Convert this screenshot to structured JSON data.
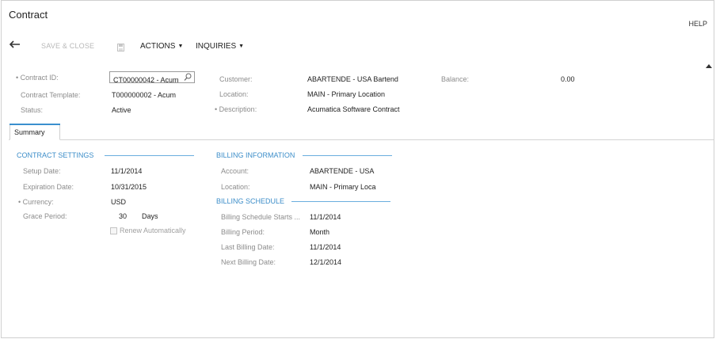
{
  "header": {
    "title": "Contract",
    "help_label": "HELP"
  },
  "toolbar": {
    "back_icon": "back-arrow-icon",
    "save_close_label": "SAVE & CLOSE",
    "save_icon": "disk-icon",
    "actions_label": "ACTIONS",
    "inquiries_label": "INQUIRIES",
    "dropdown_icon": "caret-down-icon"
  },
  "form": {
    "contract_id": {
      "label": "Contract ID:",
      "required_mark": "•",
      "value": "CT00000042 - Acum"
    },
    "contract_template": {
      "label": "Contract Template:",
      "value": "T000000002 - Acum"
    },
    "status": {
      "label": "Status:",
      "value": "Active"
    },
    "customer": {
      "label": "Customer:",
      "value": "ABARTENDE - USA Bartend"
    },
    "location": {
      "label": "Location:",
      "value": "MAIN - Primary Location"
    },
    "description": {
      "label": "Description:",
      "required_mark": "•",
      "value": "Acumatica Software Contract"
    },
    "balance": {
      "label": "Balance:",
      "value": "0.00"
    }
  },
  "tabs": [
    {
      "label": "Summary",
      "active": true
    }
  ],
  "contract_settings": {
    "heading": "CONTRACT SETTINGS",
    "setup_date": {
      "label": "Setup Date:",
      "value": "11/1/2014"
    },
    "expiration_date": {
      "label": "Expiration Date:",
      "value": "10/31/2015"
    },
    "currency": {
      "label": "Currency:",
      "required_mark": "•",
      "value": "USD"
    },
    "grace_period": {
      "label": "Grace Period:",
      "value": "30",
      "unit": "Days"
    },
    "renew_automatically": {
      "label": "Renew Automatically",
      "checked": false
    }
  },
  "billing_information": {
    "heading": "BILLING INFORMATION",
    "account": {
      "label": "Account:",
      "value": "ABARTENDE - USA"
    },
    "location": {
      "label": "Location:",
      "value": "MAIN - Primary Loca"
    }
  },
  "billing_schedule": {
    "heading": "BILLING SCHEDULE",
    "starts": {
      "label": "Billing Schedule Starts ...",
      "value": "11/1/2014"
    },
    "period": {
      "label": "Billing Period:",
      "value": "Month"
    },
    "last_date": {
      "label": "Last Billing Date:",
      "value": "11/1/2014"
    },
    "next_date": {
      "label": "Next Billing Date:",
      "value": "12/1/2014"
    }
  },
  "colors": {
    "section_heading": "#3d8ec9",
    "label_gray": "#8c8c8c",
    "disabled_gray": "#b8b8b8",
    "tab_accent": "#3a8fce"
  }
}
